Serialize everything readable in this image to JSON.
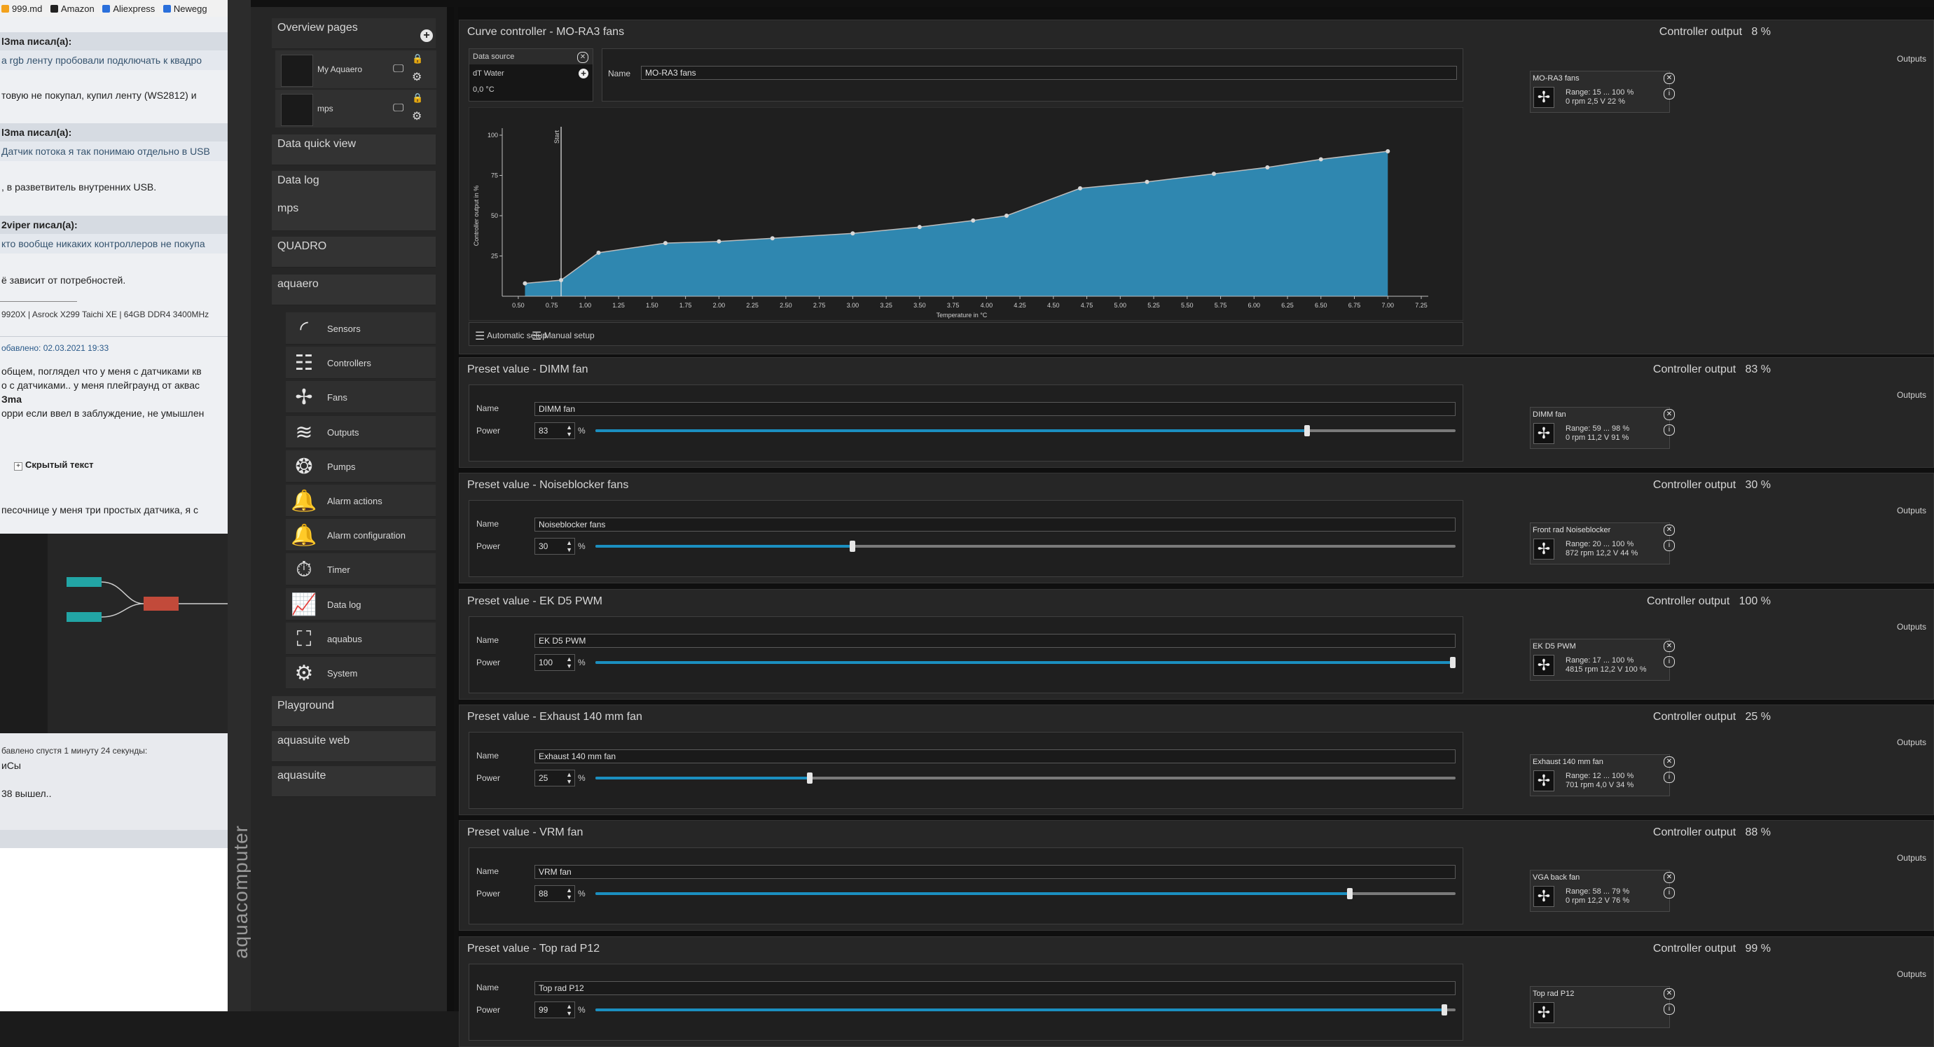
{
  "browser": {
    "bookmarks": [
      "999.md",
      "Amazon",
      "Aliexpress",
      "Newegg"
    ],
    "forum": {
      "headers": [
        "lЗma писал(а):",
        "lЗma писал(а):",
        "2viper писал(а):"
      ],
      "quotes": [
        "a rgb ленту пробовали подключать к квадро",
        "Датчик потока я так понимаю отдельно в USB",
        "кто вообще никаких контроллеров не покупа"
      ],
      "texts": [
        "товую не покупал, купил ленту (WS2812) и",
        ", в разветвитель внутренних USB.",
        "ё зависит от потребностей."
      ],
      "signature": "9920X | Asrock X299 Taichi XE | 64GB DDR4 3400MHz",
      "post_meta": "обавлено: 02.03.2021 19:33",
      "post_lines": [
        "общем, поглядел что у меня с датчиками кв",
        "о с датчиками.. у меня плейграунд от аквас",
        "Зma",
        "орри если ввел в заблуждение, не умышлен"
      ],
      "spoiler": "Скрытый текст",
      "post_line2": "песочнице у меня три простых датчика, я с",
      "added_later": "бавлено спустя 1 минуту 24 секунды:",
      "ps": "иСы",
      "released": "38 вышел.."
    }
  },
  "app": {
    "brand": "aquacomputer",
    "sidebar": {
      "overview_header": "Overview pages",
      "overview_items": [
        "My Aquaero",
        "mps"
      ],
      "nav_top": [
        "Data quick view",
        "Data log",
        "mps",
        "QUADRO",
        "aquaero"
      ],
      "sub_items": [
        {
          "label": "Sensors",
          "icon": "gauge-icon"
        },
        {
          "label": "Controllers",
          "icon": "sliders-icon"
        },
        {
          "label": "Fans",
          "icon": "fan-icon"
        },
        {
          "label": "Outputs",
          "icon": "outputs-icon"
        },
        {
          "label": "Pumps",
          "icon": "pump-icon"
        },
        {
          "label": "Alarm actions",
          "icon": "bell-icon"
        },
        {
          "label": "Alarm configuration",
          "icon": "alarm-config-icon"
        },
        {
          "label": "Timer",
          "icon": "timer-icon"
        },
        {
          "label": "Data log",
          "icon": "chart-line-icon"
        },
        {
          "label": "aquabus",
          "icon": "network-icon"
        },
        {
          "label": "System",
          "icon": "gear-icon"
        }
      ],
      "nav_bottom": [
        "Playground",
        "aquasuite web",
        "aquasuite"
      ]
    },
    "curve": {
      "title": "Curve controller  -  MO-RA3 fans",
      "output_label": "Controller output",
      "output_value": "8 %",
      "data_source_label": "Data source",
      "data_source_value": "dT Water",
      "data_source_reading": "0,0 °C",
      "name_label": "Name",
      "name_value": "MO-RA3 fans",
      "automatic_setup": "Automatic setup",
      "manual_setup": "Manual setup",
      "outputs_label": "Outputs",
      "output_card": {
        "name": "MO-RA3 fans",
        "range": "Range:  15 ... 100  %",
        "status": "0 rpm  2,5 V  22 %"
      }
    },
    "presets": [
      {
        "title": "Preset value  -  DIMM fan",
        "output_label": "Controller output",
        "output_value": "83 %",
        "name": "DIMM fan",
        "power": "83",
        "power_frac": 0.83,
        "card_name": "DIMM fan",
        "card_range": "Range:  59 ... 98  %",
        "card_status": "0 rpm  11,2 V  91 %"
      },
      {
        "title": "Preset value  -  Noiseblocker fans",
        "output_label": "Controller output",
        "output_value": "30 %",
        "name": "Noiseblocker fans",
        "power": "30",
        "power_frac": 0.3,
        "card_name": "Front rad Noiseblocker",
        "card_range": "Range:  20 ... 100  %",
        "card_status": "872 rpm  12,2 V  44 %"
      },
      {
        "title": "Preset value  -  EK D5 PWM",
        "output_label": "Controller output",
        "output_value": "100 %",
        "name": "EK D5 PWM",
        "power": "100",
        "power_frac": 1.0,
        "card_name": "EK D5 PWM",
        "card_range": "Range:  17 ... 100  %",
        "card_status": "4815 rpm  12,2 V  100 %"
      },
      {
        "title": "Preset value  -  Exhaust 140 mm fan",
        "output_label": "Controller output",
        "output_value": "25 %",
        "name": "Exhaust 140 mm fan",
        "power": "25",
        "power_frac": 0.25,
        "card_name": "Exhaust 140 mm fan",
        "card_range": "Range:  12 ... 100  %",
        "card_status": "701 rpm  4,0 V  34 %"
      },
      {
        "title": "Preset value  -  VRM fan",
        "output_label": "Controller output",
        "output_value": "88 %",
        "name": "VRM fan",
        "power": "88",
        "power_frac": 0.88,
        "card_name": "VGA back fan",
        "card_range": "Range:  58 ... 79  %",
        "card_status": "0 rpm  12,2 V  76 %"
      },
      {
        "title": "Preset value  -  Top rad P12",
        "output_label": "Controller output",
        "output_value": "99 %",
        "name": "Top rad P12",
        "power": "99",
        "power_frac": 0.99,
        "card_name": "Top rad P12",
        "card_range": "",
        "card_status": ""
      }
    ],
    "preset_labels": {
      "name": "Name",
      "power": "Power",
      "percent": "%",
      "outputs": "Outputs"
    }
  },
  "chart_data": {
    "type": "area",
    "xlabel": "Temperature in °C",
    "ylabel": "Controller output in %",
    "xlim": [
      0.38,
      7.25
    ],
    "ylim": [
      0,
      100
    ],
    "x_ticks": [
      "0.50",
      "0.75",
      "1.00",
      "1.25",
      "1.50",
      "1.75",
      "2.00",
      "2.25",
      "2.50",
      "2.75",
      "3.00",
      "3.25",
      "3.50",
      "3.75",
      "4.00",
      "4.25",
      "4.50",
      "4.75",
      "5.00",
      "5.25",
      "5.50",
      "5.75",
      "6.00",
      "6.25",
      "6.50",
      "6.75",
      "7.00",
      "7.25"
    ],
    "y_ticks": [
      "100",
      "75",
      "50",
      "25"
    ],
    "start_marker_label": "Start",
    "start_marker_x": 0.82,
    "x": [
      0.55,
      0.82,
      1.1,
      1.6,
      2.0,
      2.4,
      3.0,
      3.5,
      3.9,
      4.15,
      4.7,
      5.2,
      5.7,
      6.1,
      6.5,
      7.0
    ],
    "y": [
      8,
      10,
      27,
      33,
      34,
      36,
      39,
      43,
      47,
      50,
      67,
      71,
      76,
      80,
      85,
      90
    ],
    "fill_color": "#2f87b0",
    "line_color": "#bcbcbc"
  }
}
